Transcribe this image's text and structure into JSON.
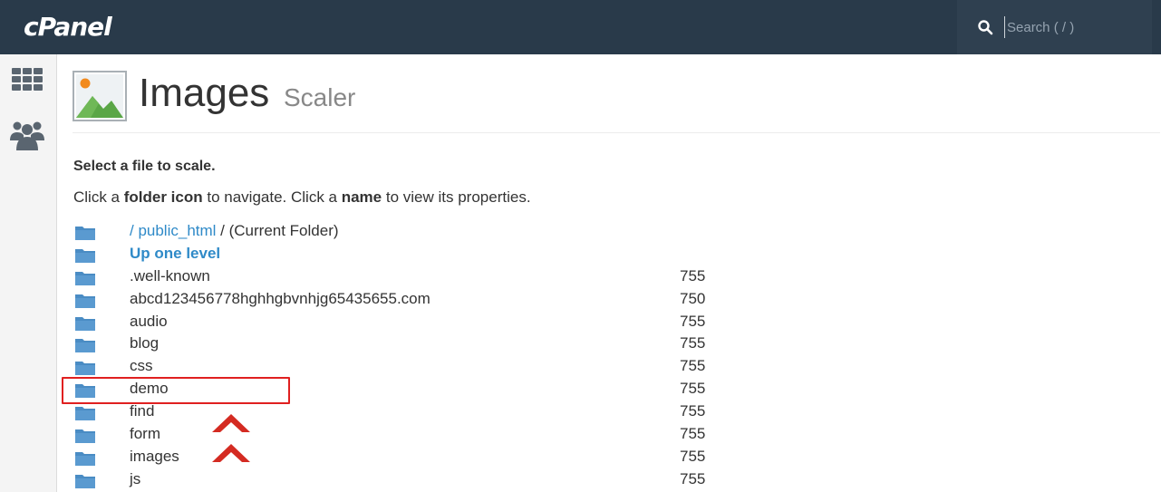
{
  "topbar": {
    "logo": "cPanel",
    "search_placeholder": "Search ( / )"
  },
  "sidebar": {
    "items": [
      {
        "icon": "grid-icon"
      },
      {
        "icon": "users-icon"
      }
    ]
  },
  "header": {
    "title": "Images",
    "subtitle": "Scaler"
  },
  "instructions": {
    "title": "Select a file to scale.",
    "line_parts": [
      "Click a ",
      "folder icon",
      " to navigate. Click a ",
      "name",
      " to view its properties."
    ]
  },
  "current_folder": {
    "path": "/ public_html",
    "suffix": " / (Current Folder)"
  },
  "up_one_level": "Up one level",
  "folders": [
    {
      "name": ".well-known",
      "perm": "755"
    },
    {
      "name": "abcd123456778hghhgbvnhjg65435655.com",
      "perm": "750"
    },
    {
      "name": "audio",
      "perm": "755"
    },
    {
      "name": "blog",
      "perm": "755"
    },
    {
      "name": "css",
      "perm": "755"
    },
    {
      "name": "demo",
      "perm": "755"
    },
    {
      "name": "find",
      "perm": "755"
    },
    {
      "name": "form",
      "perm": "755"
    },
    {
      "name": "images",
      "perm": "755"
    },
    {
      "name": "js",
      "perm": "755"
    }
  ],
  "colors": {
    "topbar": "#293a4a",
    "link": "#2f8ac8",
    "folder": "#4a8cc4",
    "highlight": "#e02020"
  }
}
